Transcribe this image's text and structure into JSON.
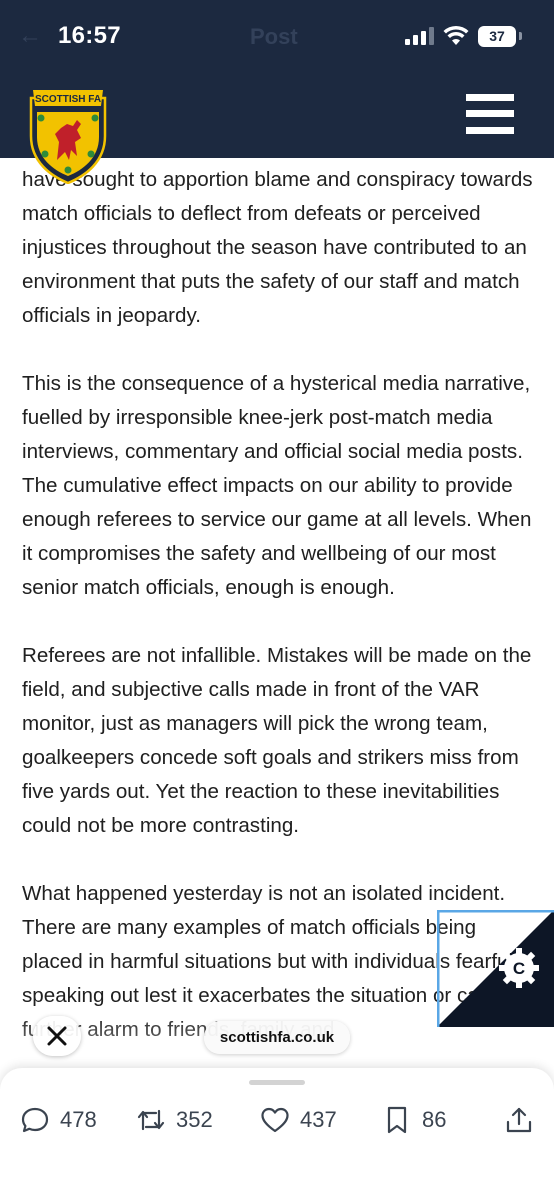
{
  "status_bar": {
    "time": "16:57",
    "battery": "37",
    "ghost_back": "←",
    "ghost_title": "Post",
    "icons": [
      "signal-icon",
      "wifi-icon",
      "battery-icon"
    ]
  },
  "header": {
    "logo_text": "SCOTTISH FA",
    "menu_icon": "hamburger-menu-icon",
    "background": "#1c2940"
  },
  "article": {
    "paragraphs": [
      "have sought to apportion blame and conspiracy towards match officials to deflect from defeats or perceived injustices throughout the season have contributed to an environment that puts the safety of our staff and match officials in jeopardy.",
      "This is the consequence of a hysterical media narrative, fuelled by irresponsible knee-jerk post-match media interviews, commentary and official social media posts. The cumulative effect impacts on our ability to provide enough referees to service our game at all levels. When it compromises the safety and wellbeing of our most senior match officials, enough is enough.",
      "Referees are not infallible. Mistakes will be made on the field, and subjective calls made in front of the VAR monitor, just as managers will pick the wrong team, goalkeepers concede soft goals and strikers miss from five yards out. Yet the reaction to these inevitabilities could not be more contrasting.",
      "What happened yesterday is not an isolated incident. There are many examples of match officials being placed in harmful situations but with individuals fearful of speaking out lest it exacerbates the situation or causes further alarm to friends, family and"
    ]
  },
  "overlay": {
    "url": "scottishfa.co.uk",
    "close_icon": "close-icon",
    "cookie_icon": "cookie-settings-icon"
  },
  "actions": {
    "replies": "478",
    "reposts": "352",
    "likes": "437",
    "bookmarks": "86",
    "icons": [
      "reply-icon",
      "repost-icon",
      "like-icon",
      "bookmark-icon",
      "share-icon"
    ]
  },
  "colors": {
    "navy": "#1c2940",
    "gold": "#f2c200",
    "lion_red": "#c0202a",
    "accent_blue": "#5aa7e6"
  }
}
